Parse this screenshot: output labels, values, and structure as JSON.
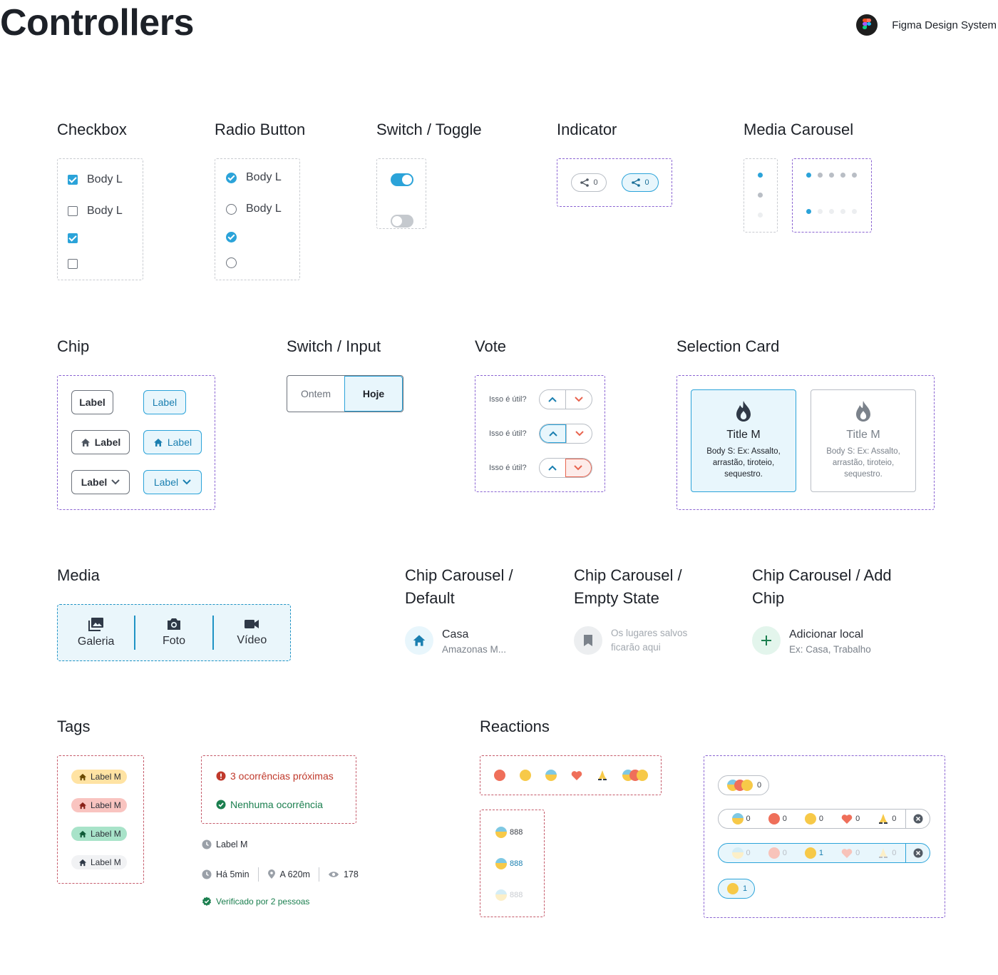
{
  "header": {
    "title": "Controllers",
    "brand": "Figma Design System"
  },
  "sections": {
    "checkbox": "Checkbox",
    "radio": "Radio Button",
    "switch_toggle": "Switch / Toggle",
    "indicator": "Indicator",
    "media_carousel": "Media Carousel",
    "chip": "Chip",
    "switch_input": "Switch / Input",
    "vote": "Vote",
    "selection_card": "Selection Card",
    "media": "Media",
    "cc_default": "Chip Carousel / Default",
    "cc_empty": "Chip Carousel / Empty State",
    "cc_add": "Chip Carousel / Add Chip",
    "tags": "Tags",
    "reactions": "Reactions"
  },
  "checkbox": {
    "label_checked": "Body L",
    "label_unchecked": "Body L"
  },
  "radio": {
    "label_checked": "Body L",
    "label_unchecked": "Body L"
  },
  "indicator": {
    "count_default": "0",
    "count_active": "0"
  },
  "chip": {
    "label": "Label"
  },
  "switch_input": {
    "option_1": "Ontem",
    "option_2": "Hoje"
  },
  "vote": {
    "question": "Isso é útil?"
  },
  "selection_card": {
    "title": "Title M",
    "body": "Body S: Ex: Assalto, arrastão, tiroteio, sequestro."
  },
  "media": {
    "gallery": "Galeria",
    "photo": "Foto",
    "video": "Vídeo"
  },
  "chip_carousel": {
    "default_title": "Casa",
    "default_sub": "Amazonas M...",
    "empty_line1": "Os lugares salvos",
    "empty_line2": "ficarão aqui",
    "add_title": "Adicionar local",
    "add_sub": "Ex: Casa, Trabalho"
  },
  "tags": {
    "label_m": "Label M",
    "alert": "3 ocorrências próximas",
    "ok": "Nenhuma ocorrência",
    "meta_label": "Label M",
    "time": "Há 5min",
    "distance": "A 620m",
    "views": "178",
    "verified": "Verificado por 2 pessoas"
  },
  "reactions": {
    "count_888": "888",
    "zero": "0",
    "one": "1"
  },
  "colors": {
    "accent": "#2ba3d9",
    "purple_dash": "#8a63d2",
    "danger": "#c0392b",
    "success": "#1b7f4f"
  }
}
